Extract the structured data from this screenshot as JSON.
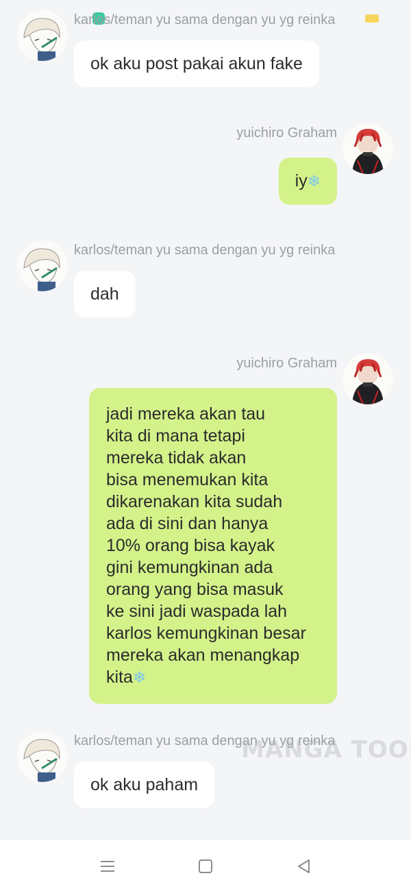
{
  "participants": {
    "karlos": "karlos/teman yu sama dengan yu yg reinka",
    "yuichiro": "yuichiro Graham"
  },
  "messages": [
    {
      "side": "left",
      "sender": "karlos/teman yu sama dengan yu yg reinka",
      "lines": [
        "ok aku post pakai akun fake"
      ]
    },
    {
      "side": "right",
      "sender": "yuichiro Graham",
      "lines": [
        "iy"
      ],
      "trailing_emoji": "❄"
    },
    {
      "side": "left",
      "sender": "karlos/teman yu sama dengan yu yg reinka",
      "lines": [
        "dah"
      ]
    },
    {
      "side": "right",
      "sender": "yuichiro Graham",
      "lines": [
        "jadi mereka akan tau",
        "kita di mana tetapi",
        "mereka tidak akan",
        "bisa menemukan kita",
        "dikarenakan kita sudah",
        "ada di sini dan hanya",
        "10% orang bisa kayak",
        "gini kemungkinan ada",
        "orang yang bisa masuk",
        "ke sini jadi waspada lah",
        "karlos kemungkinan besar",
        "mereka akan menangkap",
        "kita"
      ],
      "trailing_emoji": "❄"
    },
    {
      "side": "left",
      "sender": "karlos/teman yu sama dengan yu yg reinka",
      "lines": [
        "ok aku paham"
      ]
    }
  ],
  "watermark": "MANGA TOON",
  "icons": {
    "menu": "menu-icon",
    "home": "square-home-icon",
    "back": "triangle-back-icon"
  },
  "colors": {
    "background": "#f4f5f7",
    "bubble_left": "#ffffff",
    "bubble_right": "#d3f28a",
    "sender_text": "#9b9ea3",
    "status_green": "#3ec9a0",
    "status_yellow": "#f6d55c"
  }
}
